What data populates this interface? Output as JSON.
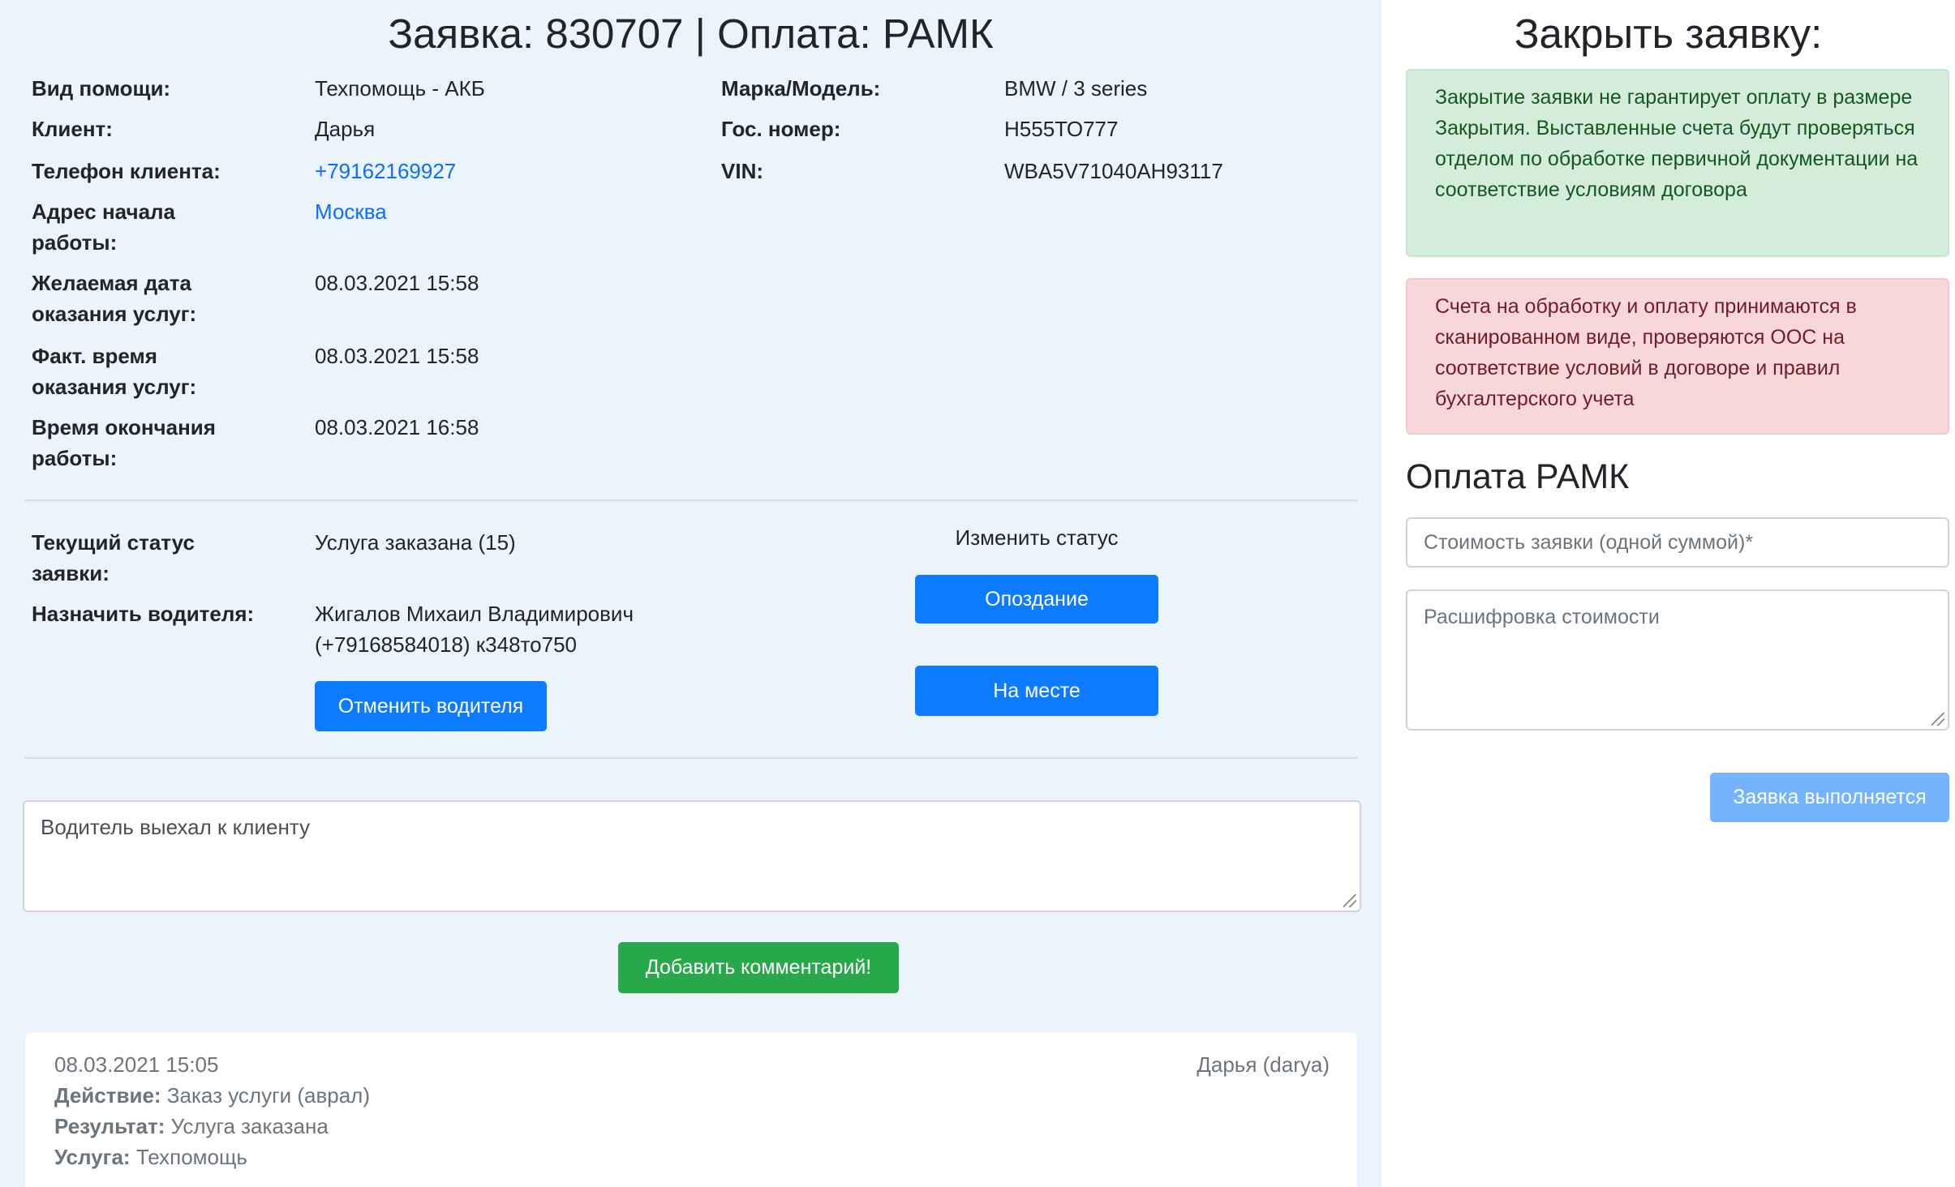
{
  "header": {
    "title": "Заявка: 830707 | Оплата: РАМК"
  },
  "details_left": [
    {
      "label": "Вид помощи:",
      "value": "Техпомощь - АКБ"
    },
    {
      "label": "Клиент:",
      "value": "Дарья"
    },
    {
      "label": "Телефон клиента:",
      "value": "+79162169927"
    },
    {
      "label": "Адрес начала работы:",
      "value": "Москва"
    },
    {
      "label": "Желаемая дата оказания услуг:",
      "value": "08.03.2021 15:58"
    },
    {
      "label": "Факт. время оказания услуг:",
      "value": "08.03.2021 15:58"
    },
    {
      "label": "Время окончания работы:",
      "value": "08.03.2021 16:58"
    }
  ],
  "details_right": [
    {
      "label": "Марка/Модель:",
      "value": "BMW / 3 series"
    },
    {
      "label": "Гос. номер:",
      "value": "Н555ТО777"
    },
    {
      "label": "VIN:",
      "value": "WBA5V71040AH93117"
    }
  ],
  "status": {
    "current_label": "Текущий статус заявки:",
    "current_value": "Услуга заказана (15)",
    "driver_label": "Назначить водителя:",
    "driver_value": "Жигалов Михаил Владимирович (+79168584018) к348то750",
    "cancel_driver_button": "Отменить водителя",
    "change_status_label": "Изменить статус",
    "late_button": "Опоздание",
    "on_site_button": "На месте"
  },
  "comment": {
    "text": "Водитель выехал к клиенту",
    "add_button": "Добавить комментарий!"
  },
  "history": [
    {
      "date": "08.03.2021 15:05",
      "user": "Дарья (darya)",
      "action_label": "Действие:",
      "action_value": "Заказ услуги (аврал)",
      "result_label": "Результат:",
      "result_value": "Услуга заказана",
      "service_label": "Услуга:",
      "service_value": "Техпомощь"
    }
  ],
  "close_panel": {
    "title": "Закрыть заявку:",
    "info_green": "Закрытие заявки не гарантирует оплату в размере Закрытия. Выставленные счета будут проверяться отделом по обработке первичной документации на соответствие условиям договора",
    "info_red": "Счета на обработку и оплату принимаются в сканированном виде, проверяются ООС на соответствие условий в договоре и правил бухгалтерского учета",
    "payment_title": "Оплата РАМК",
    "cost_placeholder": "Стоимость заявки (одной суммой)*",
    "breakdown_placeholder": "Расшифровка стоимости",
    "submit_button": "Заявка выполняется"
  },
  "colors": {
    "left_bg": "#ebf4fa",
    "primary": "#0d7bff",
    "success": "#27a84a",
    "link": "#0d6efd",
    "alert_green_bg": "#d4edda",
    "alert_red_bg": "#f8d7da"
  }
}
